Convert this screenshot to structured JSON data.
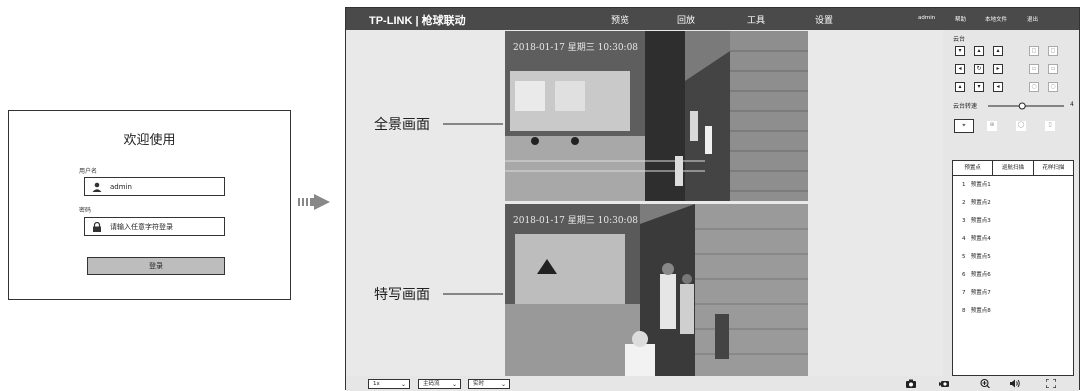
{
  "login": {
    "title": "欢迎使用",
    "username_label": "用户名",
    "username_value": "admin",
    "password_label": "密码",
    "password_placeholder": "请输入任意字符登录",
    "submit_label": "登录"
  },
  "app": {
    "brand": "TP-LINK | 枪球联动",
    "nav": [
      "预览",
      "回放",
      "工具",
      "设置"
    ],
    "util": [
      "admin",
      "帮助",
      "本地文件",
      "退出"
    ]
  },
  "viewer": {
    "panorama": {
      "label": "全景画面",
      "timestamp": "2018-01-17 星期三 10:30:08"
    },
    "closeup": {
      "label": "特写画面",
      "timestamp": "2018-01-17 星期三 10:30:08"
    }
  },
  "ptz": {
    "title": "云台",
    "speed_label": "云台转速",
    "speed_value": "4",
    "speed_fraction": 0.45
  },
  "presets": {
    "tabs": [
      "预置点",
      "巡航扫描",
      "花样扫描"
    ],
    "items": [
      {
        "num": "1",
        "name": "预置点1"
      },
      {
        "num": "2",
        "name": "预置点2"
      },
      {
        "num": "3",
        "name": "预置点3"
      },
      {
        "num": "4",
        "name": "预置点4"
      },
      {
        "num": "5",
        "name": "预置点5"
      },
      {
        "num": "6",
        "name": "预置点6"
      },
      {
        "num": "7",
        "name": "预置点7"
      },
      {
        "num": "8",
        "name": "预置点8"
      }
    ]
  },
  "bottombar": {
    "speed_select": "1x",
    "stream_select": "主码流",
    "mode_select": "实时"
  }
}
